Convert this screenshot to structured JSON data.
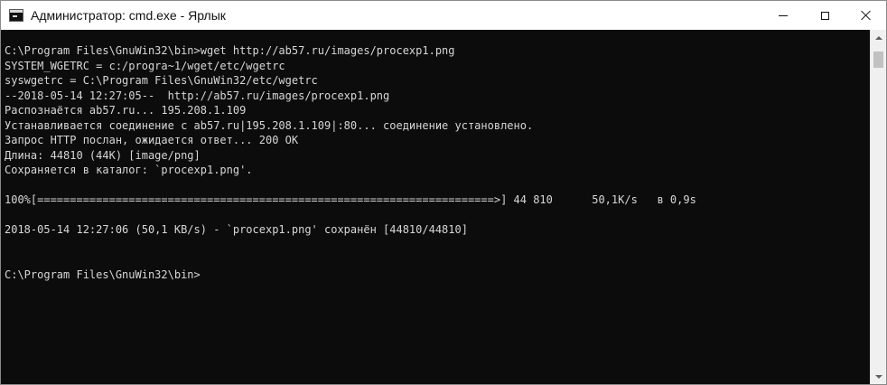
{
  "window": {
    "title": "Администратор: cmd.exe - Ярлык",
    "icon": "command-prompt-icon"
  },
  "titlebar_buttons": {
    "minimize": "minimize-icon",
    "maximize": "maximize-icon",
    "close": "close-icon"
  },
  "console": {
    "background": "#0c0c0c",
    "foreground": "#d7d7d7",
    "lines": [
      "C:\\Program Files\\GnuWin32\\bin>wget http://ab57.ru/images/procexp1.png",
      "SYSTEM_WGETRC = c:/progra~1/wget/etc/wgetrc",
      "syswgetrc = C:\\Program Files\\GnuWin32/etc/wgetrc",
      "--2018-05-14 12:27:05--  http://ab57.ru/images/procexp1.png",
      "Распознаётся ab57.ru... 195.208.1.109",
      "Устанавливается соединение с ab57.ru|195.208.1.109|:80... соединение установлено.",
      "Запрос HTTP послан, ожидается ответ... 200 OK",
      "Длина: 44810 (44K) [image/png]",
      "Сохраняется в каталог: `procexp1.png'.",
      "",
      "100%[======================================================================>] 44 810      50,1K/s   в 0,9s",
      "",
      "2018-05-14 12:27:06 (50,1 KB/s) - `procexp1.png' сохранён [44810/44810]",
      "",
      "",
      "C:\\Program Files\\GnuWin32\\bin>"
    ]
  },
  "scrollbar": {
    "up_icon": "scroll-up-arrow-icon",
    "down_icon": "scroll-down-arrow-icon"
  }
}
